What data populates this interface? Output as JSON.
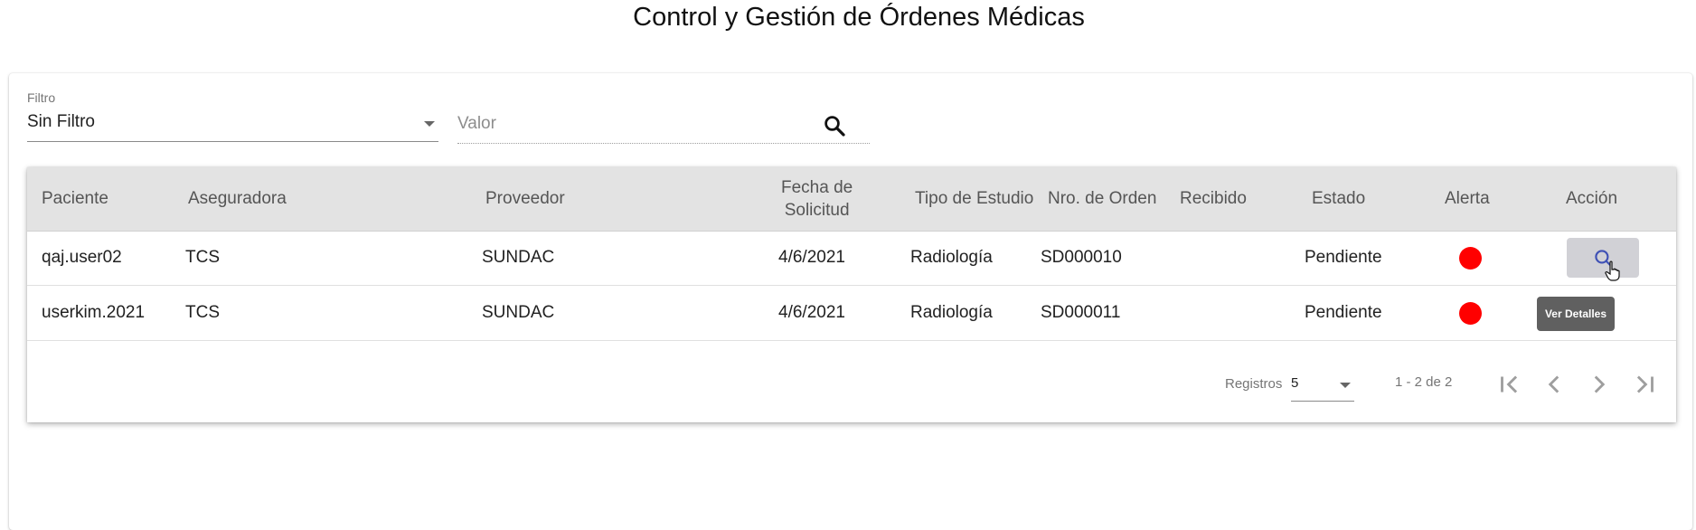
{
  "page": {
    "title": "Control y Gestión de Órdenes Médicas"
  },
  "filter": {
    "label": "Filtro",
    "selected": "Sin Filtro",
    "value_placeholder": "Valor",
    "value": ""
  },
  "table": {
    "columns": [
      "Paciente",
      "Aseguradora",
      "Proveedor",
      "Fecha de Solicitud",
      "Tipo de Estudio",
      "Nro. de Orden",
      "Recibido",
      "Estado",
      "Alerta",
      "Acción"
    ],
    "fecha_header_lines": [
      "Fecha de",
      "Solicitud"
    ],
    "rows": [
      {
        "paciente": "qaj.user02",
        "aseguradora": "TCS",
        "proveedor": "SUNDAC",
        "fecha": "4/6/2021",
        "tipo": "Radiología",
        "orden": "SD000010",
        "recibido": "",
        "estado": "Pendiente",
        "alerta": "#ff0000"
      },
      {
        "paciente": "userkim.2021",
        "aseguradora": "TCS",
        "proveedor": "SUNDAC",
        "fecha": "4/6/2021",
        "tipo": "Radiología",
        "orden": "SD000011",
        "recibido": "",
        "estado": "Pendiente",
        "alerta": "#ff0000"
      }
    ],
    "action_icon": "search-icon",
    "tooltip": "Ver Detalles"
  },
  "pagination": {
    "page_size_label": "Registros",
    "page_size": "5",
    "range_text": "1 - 2 de 2",
    "icons": [
      "first-page-icon",
      "previous-page-icon",
      "next-page-icon",
      "last-page-icon"
    ]
  },
  "colors": {
    "header_bg": "#e3e3e3",
    "alert": "#ff0000",
    "action_button": "#d1d1d6",
    "tooltip_bg": "#606060",
    "icon_active": "#3f51b5"
  }
}
